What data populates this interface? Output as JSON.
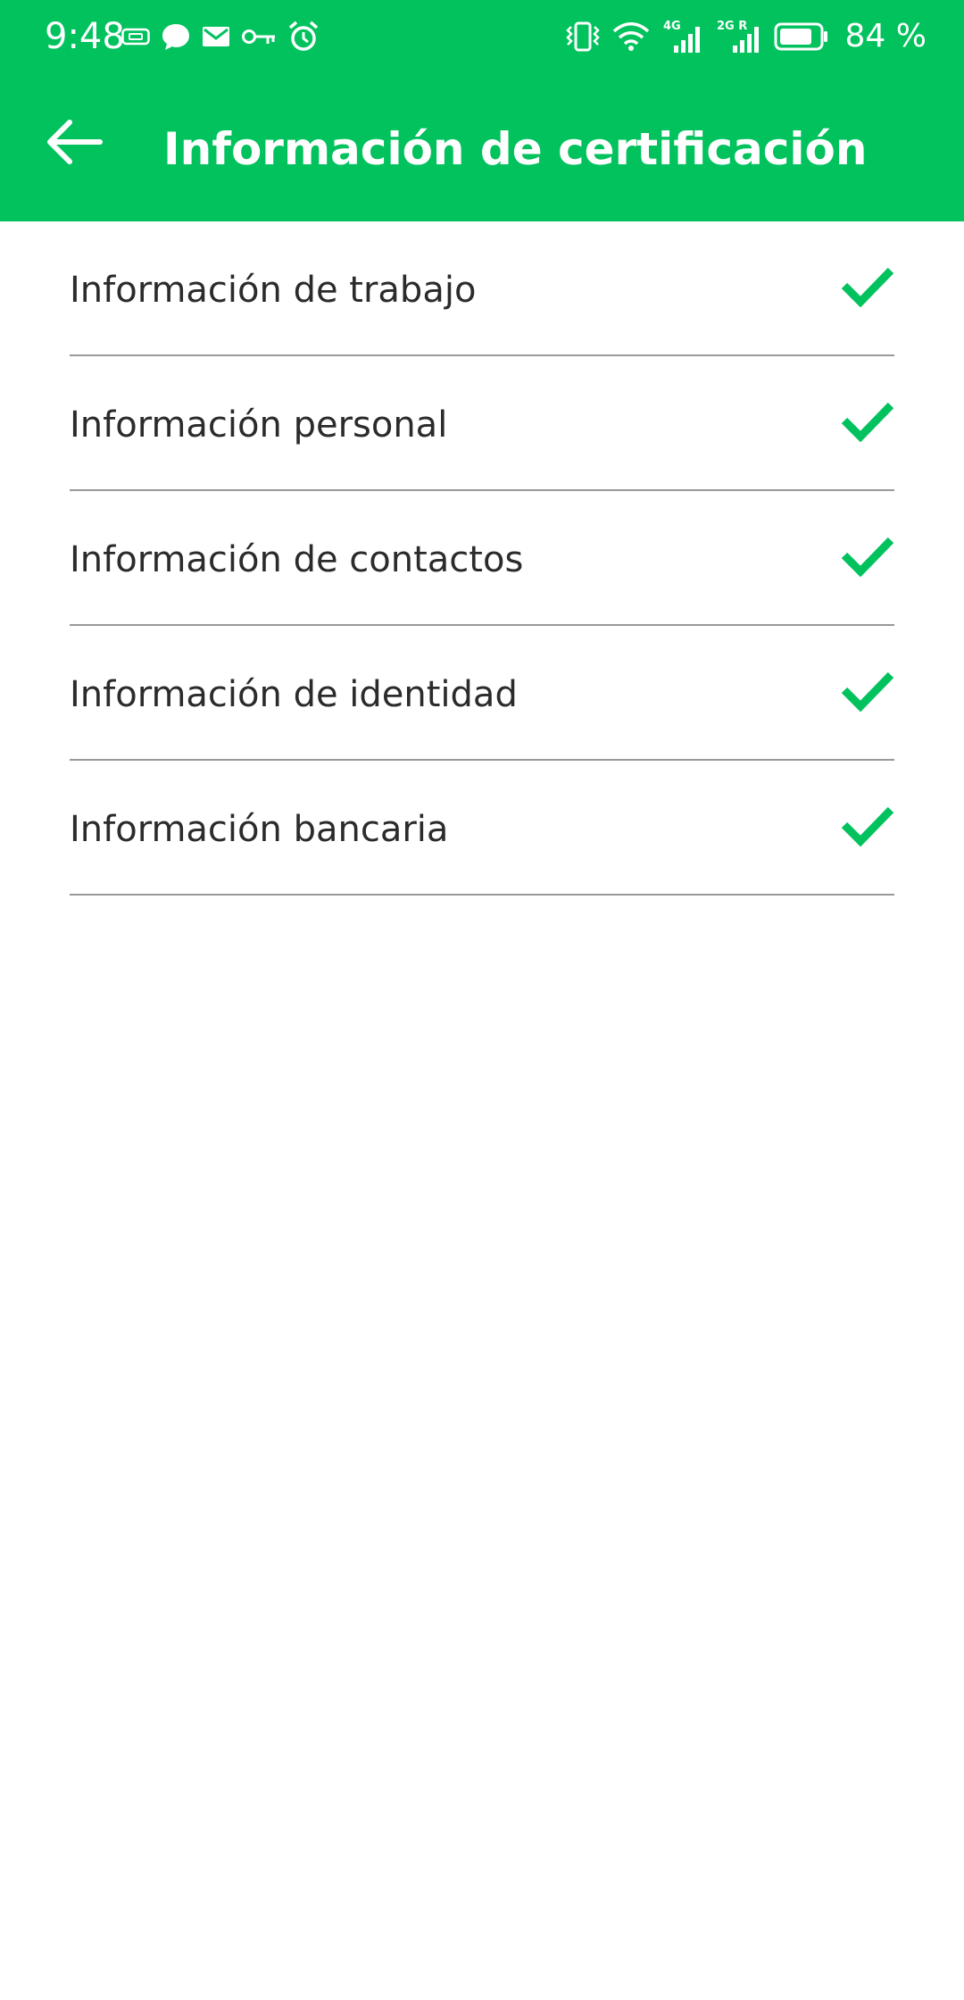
{
  "status_bar": {
    "time": "9:48",
    "battery_percent": "84 %",
    "left_icons": [
      "storage-icon",
      "chat-bubble-icon",
      "mail-icon",
      "key-icon",
      "alarm-icon"
    ],
    "right_icons": [
      "vibrate-icon",
      "wifi-icon",
      "signal-4g-icon",
      "signal-2g-icon",
      "battery-icon"
    ],
    "network_labels": {
      "sim1": "4G",
      "sim2": "2G R"
    },
    "battery_level": 0.84
  },
  "app_bar": {
    "title": "Información de certificación",
    "back_icon": "arrow-left-icon"
  },
  "colors": {
    "primary": "#02c25e",
    "check": "#02c25e",
    "text": "#2b2b2b",
    "divider": "#999999",
    "background": "#ffffff"
  },
  "items": [
    {
      "label": "Información de trabajo",
      "status_icon": "check-icon"
    },
    {
      "label": "Información personal",
      "status_icon": "check-icon"
    },
    {
      "label": "Información de contactos",
      "status_icon": "check-icon"
    },
    {
      "label": "Información de identidad",
      "status_icon": "check-icon"
    },
    {
      "label": "Información bancaria",
      "status_icon": "check-icon"
    }
  ]
}
